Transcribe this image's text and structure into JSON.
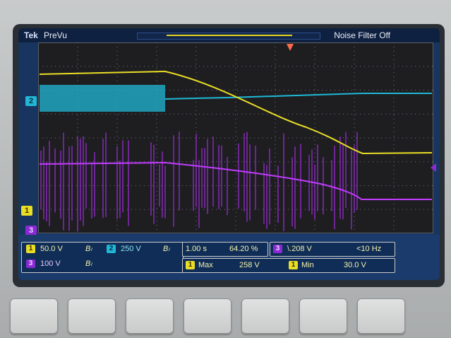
{
  "topbar": {
    "brand": "Tek",
    "mode": "PreVu",
    "noise_filter": "Noise Filter Off"
  },
  "colors": {
    "ch1": "#e9dd25",
    "ch2": "#20b8d6",
    "ch3": "#a22be0",
    "screen_bg": "#17355f",
    "graticule_bg": "#1e1e21"
  },
  "markers": {
    "ch1": "1",
    "ch2": "2",
    "ch3": "3"
  },
  "channels": [
    {
      "id": "1",
      "scale": "50.0 V",
      "bw": "Bₗ"
    },
    {
      "id": "2",
      "scale": "250 V",
      "bw": "Bₗ"
    },
    {
      "id": "3",
      "scale": "100 V",
      "bw": "Bₗ"
    }
  ],
  "timebase": {
    "time_per_div": "1.00 s",
    "position": "64.20 %"
  },
  "trigger": {
    "channel": "3",
    "slope_level": "\\.208 V",
    "freq": "<10 Hz"
  },
  "measurements": [
    {
      "channel": "1",
      "label": "Max",
      "value": "258 V"
    },
    {
      "channel": "1",
      "label": "Min",
      "value": "30.0 V"
    }
  ],
  "softkeys": [
    "",
    "",
    "",
    "",
    "",
    "",
    ""
  ]
}
